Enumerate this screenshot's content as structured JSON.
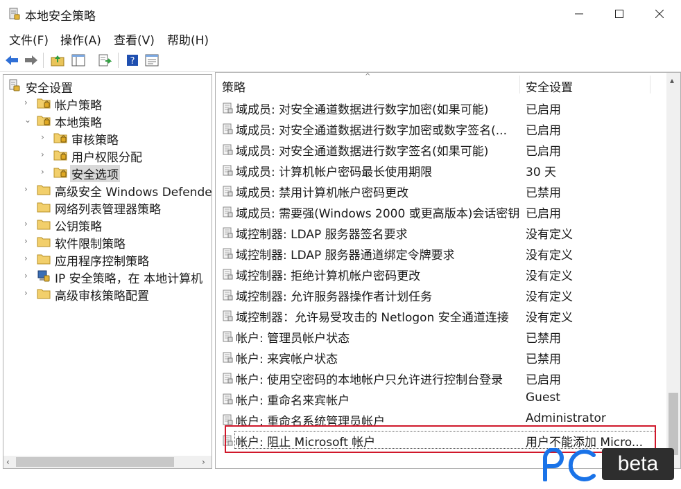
{
  "window": {
    "title": "本地安全策略"
  },
  "menu": [
    "文件(F)",
    "操作(A)",
    "查看(V)",
    "帮助(H)"
  ],
  "toolbar": {
    "icons": [
      "back-icon",
      "forward-icon",
      "up-folder-icon",
      "show-hide-tree-icon",
      "export-list-icon",
      "help-icon",
      "properties-icon"
    ]
  },
  "tree": [
    {
      "label": "安全设置",
      "level": 0,
      "expander": "",
      "icon": "security-settings-icon"
    },
    {
      "label": "帐户策略",
      "level": 1,
      "expander": "›",
      "icon": "folder-lock-icon"
    },
    {
      "label": "本地策略",
      "level": 1,
      "expander": "⌄",
      "icon": "folder-lock-icon"
    },
    {
      "label": "审核策略",
      "level": 2,
      "expander": "›",
      "icon": "folder-lock-icon"
    },
    {
      "label": "用户权限分配",
      "level": 2,
      "expander": "›",
      "icon": "folder-lock-icon"
    },
    {
      "label": "安全选项",
      "level": 2,
      "expander": "›",
      "icon": "folder-lock-icon",
      "selected": true
    },
    {
      "label": "高级安全 Windows Defender 防",
      "level": 1,
      "expander": "›",
      "icon": "folder-icon"
    },
    {
      "label": "网络列表管理器策略",
      "level": 1,
      "expander": "",
      "icon": "folder-icon"
    },
    {
      "label": "公钥策略",
      "level": 1,
      "expander": "›",
      "icon": "folder-icon"
    },
    {
      "label": "软件限制策略",
      "level": 1,
      "expander": "›",
      "icon": "folder-icon"
    },
    {
      "label": "应用程序控制策略",
      "level": 1,
      "expander": "›",
      "icon": "folder-icon"
    },
    {
      "label": "IP 安全策略，在 本地计算机",
      "level": 1,
      "expander": "›",
      "icon": "ip-security-icon"
    },
    {
      "label": "高级审核策略配置",
      "level": 1,
      "expander": "›",
      "icon": "folder-icon"
    }
  ],
  "list": {
    "columns": [
      "策略",
      "安全设置"
    ],
    "rows": [
      {
        "policy": "域成员: 对安全通道数据进行数字加密(如果可能)",
        "setting": "已启用"
      },
      {
        "policy": "域成员: 对安全通道数据进行数字加密或数字签名(...",
        "setting": "已启用"
      },
      {
        "policy": "域成员: 对安全通道数据进行数字签名(如果可能)",
        "setting": "已启用"
      },
      {
        "policy": "域成员: 计算机帐户密码最长使用期限",
        "setting": "30 天"
      },
      {
        "policy": "域成员: 禁用计算机帐户密码更改",
        "setting": "已禁用"
      },
      {
        "policy": "域成员: 需要强(Windows 2000 或更高版本)会话密钥",
        "setting": "已启用"
      },
      {
        "policy": "域控制器: LDAP 服务器签名要求",
        "setting": "没有定义"
      },
      {
        "policy": "域控制器: LDAP 服务器通道绑定令牌要求",
        "setting": "没有定义"
      },
      {
        "policy": "域控制器: 拒绝计算机帐户密码更改",
        "setting": "没有定义"
      },
      {
        "policy": "域控制器: 允许服务器操作者计划任务",
        "setting": "没有定义"
      },
      {
        "policy": "域控制器：允许易受攻击的 Netlogon 安全通道连接",
        "setting": "没有定义"
      },
      {
        "policy": "帐户: 管理员帐户状态",
        "setting": "已禁用"
      },
      {
        "policy": "帐户: 来宾帐户状态",
        "setting": "已禁用"
      },
      {
        "policy": "帐户: 使用空密码的本地帐户只允许进行控制台登录",
        "setting": "已启用"
      },
      {
        "policy": "帐户: 重命名来宾帐户",
        "setting": "Guest"
      },
      {
        "policy": "帐户: 重命名系统管理员帐户",
        "setting": "Administrator"
      },
      {
        "policy": "帐户: 阻止 Microsoft 帐户",
        "setting": "用户不能添加 Micro...",
        "focused": true
      }
    ]
  },
  "watermark": {
    "text": "beta",
    "accent": "#1a73e8"
  },
  "colors": {
    "highlight_border": "#d0172a",
    "selection": "#d9d9d9"
  }
}
